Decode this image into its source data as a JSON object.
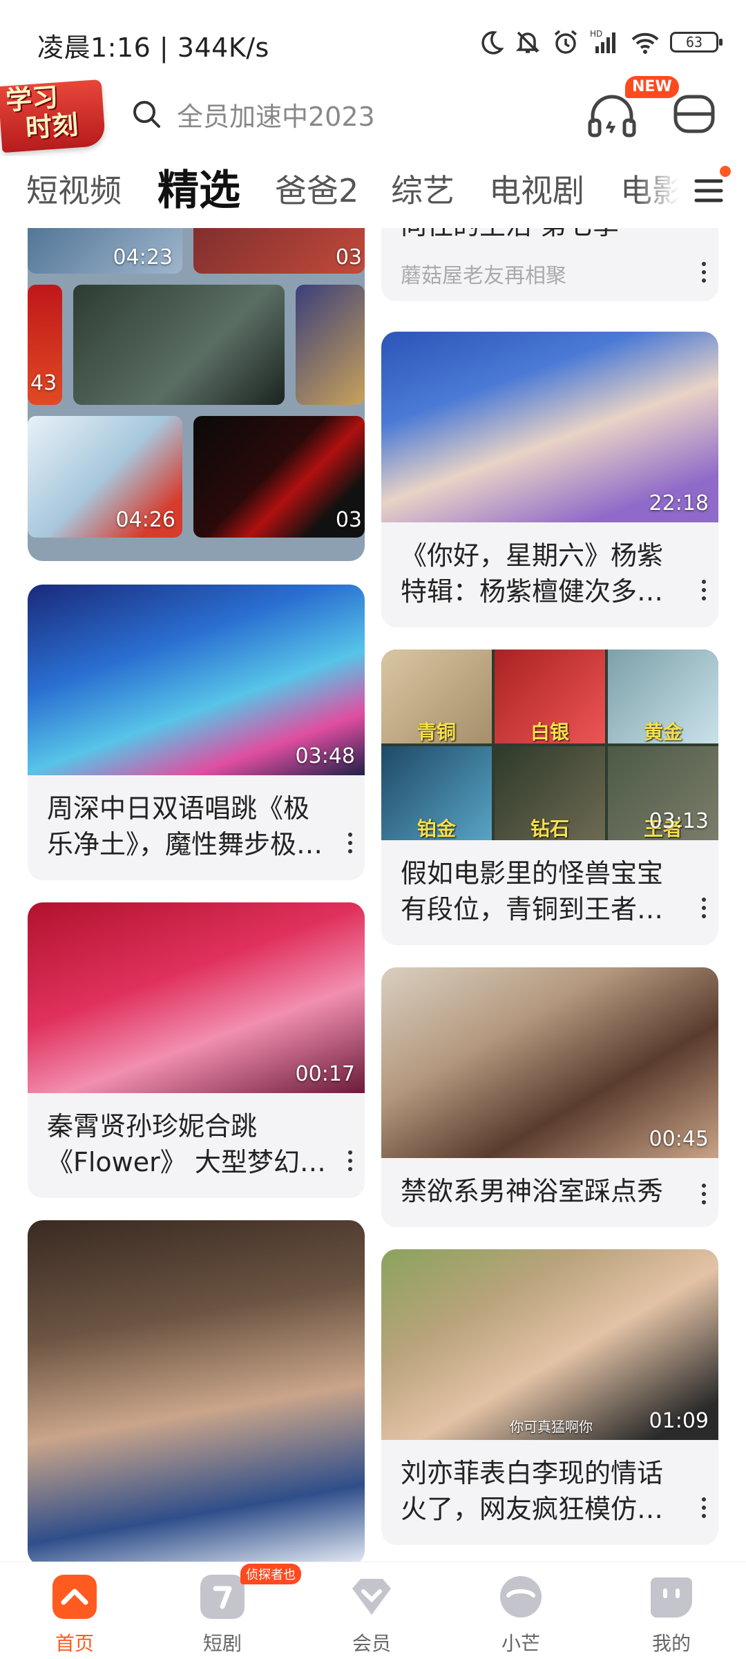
{
  "status_bar": {
    "time": "凌晨1:16 | 344K/s",
    "battery": "63"
  },
  "header": {
    "logo_line1": "学习",
    "logo_line2": "时刻",
    "search_placeholder": "全员加速中2023",
    "new_badge": "NEW"
  },
  "tabs": [
    {
      "label": "短视频",
      "active": false
    },
    {
      "label": "精选",
      "active": true
    },
    {
      "label": "爸爸2",
      "active": false
    },
    {
      "label": "综艺",
      "active": false
    },
    {
      "label": "电视剧",
      "active": false
    },
    {
      "label": "电影",
      "active": false
    }
  ],
  "feed": {
    "left": [
      {
        "collage_durations": [
          "04:23",
          "03",
          "43",
          "04:26",
          "03"
        ]
      },
      {
        "duration": "03:48",
        "title": "周深中日双语唱跳《极乐净土》，魔性舞步极致勾魂"
      },
      {
        "duration": "00:17",
        "title": "秦霄贤孙珍妮合跳《Flower》 大型梦幻联动现场"
      },
      {
        "duration": "",
        "title": ""
      }
    ],
    "right": [
      {
        "title": "向往的生活 第七季",
        "subtitle": "蘑菇屋老友再相聚"
      },
      {
        "duration": "22:18",
        "title": "《你好，星期六》杨紫特辑：杨紫檀健次多年网友见面"
      },
      {
        "duration": "03:13",
        "title": "假如电影里的怪兽宝宝有段位，青铜到王者，迷你怪兽",
        "tiers": [
          "青铜",
          "白银",
          "黄金",
          "铂金",
          "钻石",
          "王者"
        ]
      },
      {
        "duration": "00:45",
        "title": "禁欲系男神浴室踩点秀"
      },
      {
        "duration": "01:09",
        "title": "刘亦菲表白李现的情话火了，网友疯狂模仿，太甜了",
        "caption": "你可真猛啊你"
      }
    ]
  },
  "bottom_nav": [
    {
      "label": "首页",
      "active": true
    },
    {
      "label": "短剧",
      "active": false,
      "badge": "侦探者也"
    },
    {
      "label": "会员",
      "active": false
    },
    {
      "label": "小芒",
      "active": false
    },
    {
      "label": "我的",
      "active": false
    }
  ],
  "colors": {
    "accent": "#ff5a1f",
    "card_bg": "#f4f4f6",
    "text": "#222222"
  }
}
